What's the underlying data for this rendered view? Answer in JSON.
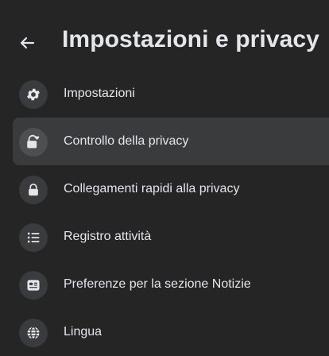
{
  "header": {
    "back_icon": "arrow-left-icon",
    "title": "Impostazioni e privacy"
  },
  "menu": {
    "items": [
      {
        "label": "Impostazioni",
        "icon": "gear-icon"
      },
      {
        "label": "Controllo della privacy",
        "icon": "lock-heart-icon",
        "selected": true
      },
      {
        "label": "Collegamenti rapidi alla privacy",
        "icon": "lock-icon"
      },
      {
        "label": "Registro attività",
        "icon": "list-icon"
      },
      {
        "label": "Preferenze per la sezione Notizie",
        "icon": "news-feed-icon"
      },
      {
        "label": "Lingua",
        "icon": "globe-icon"
      }
    ]
  },
  "colors": {
    "background": "#252526",
    "selected_row": "#3a3b3c",
    "icon_circle": "#3a3b3c",
    "text": "#e4e6eb"
  }
}
